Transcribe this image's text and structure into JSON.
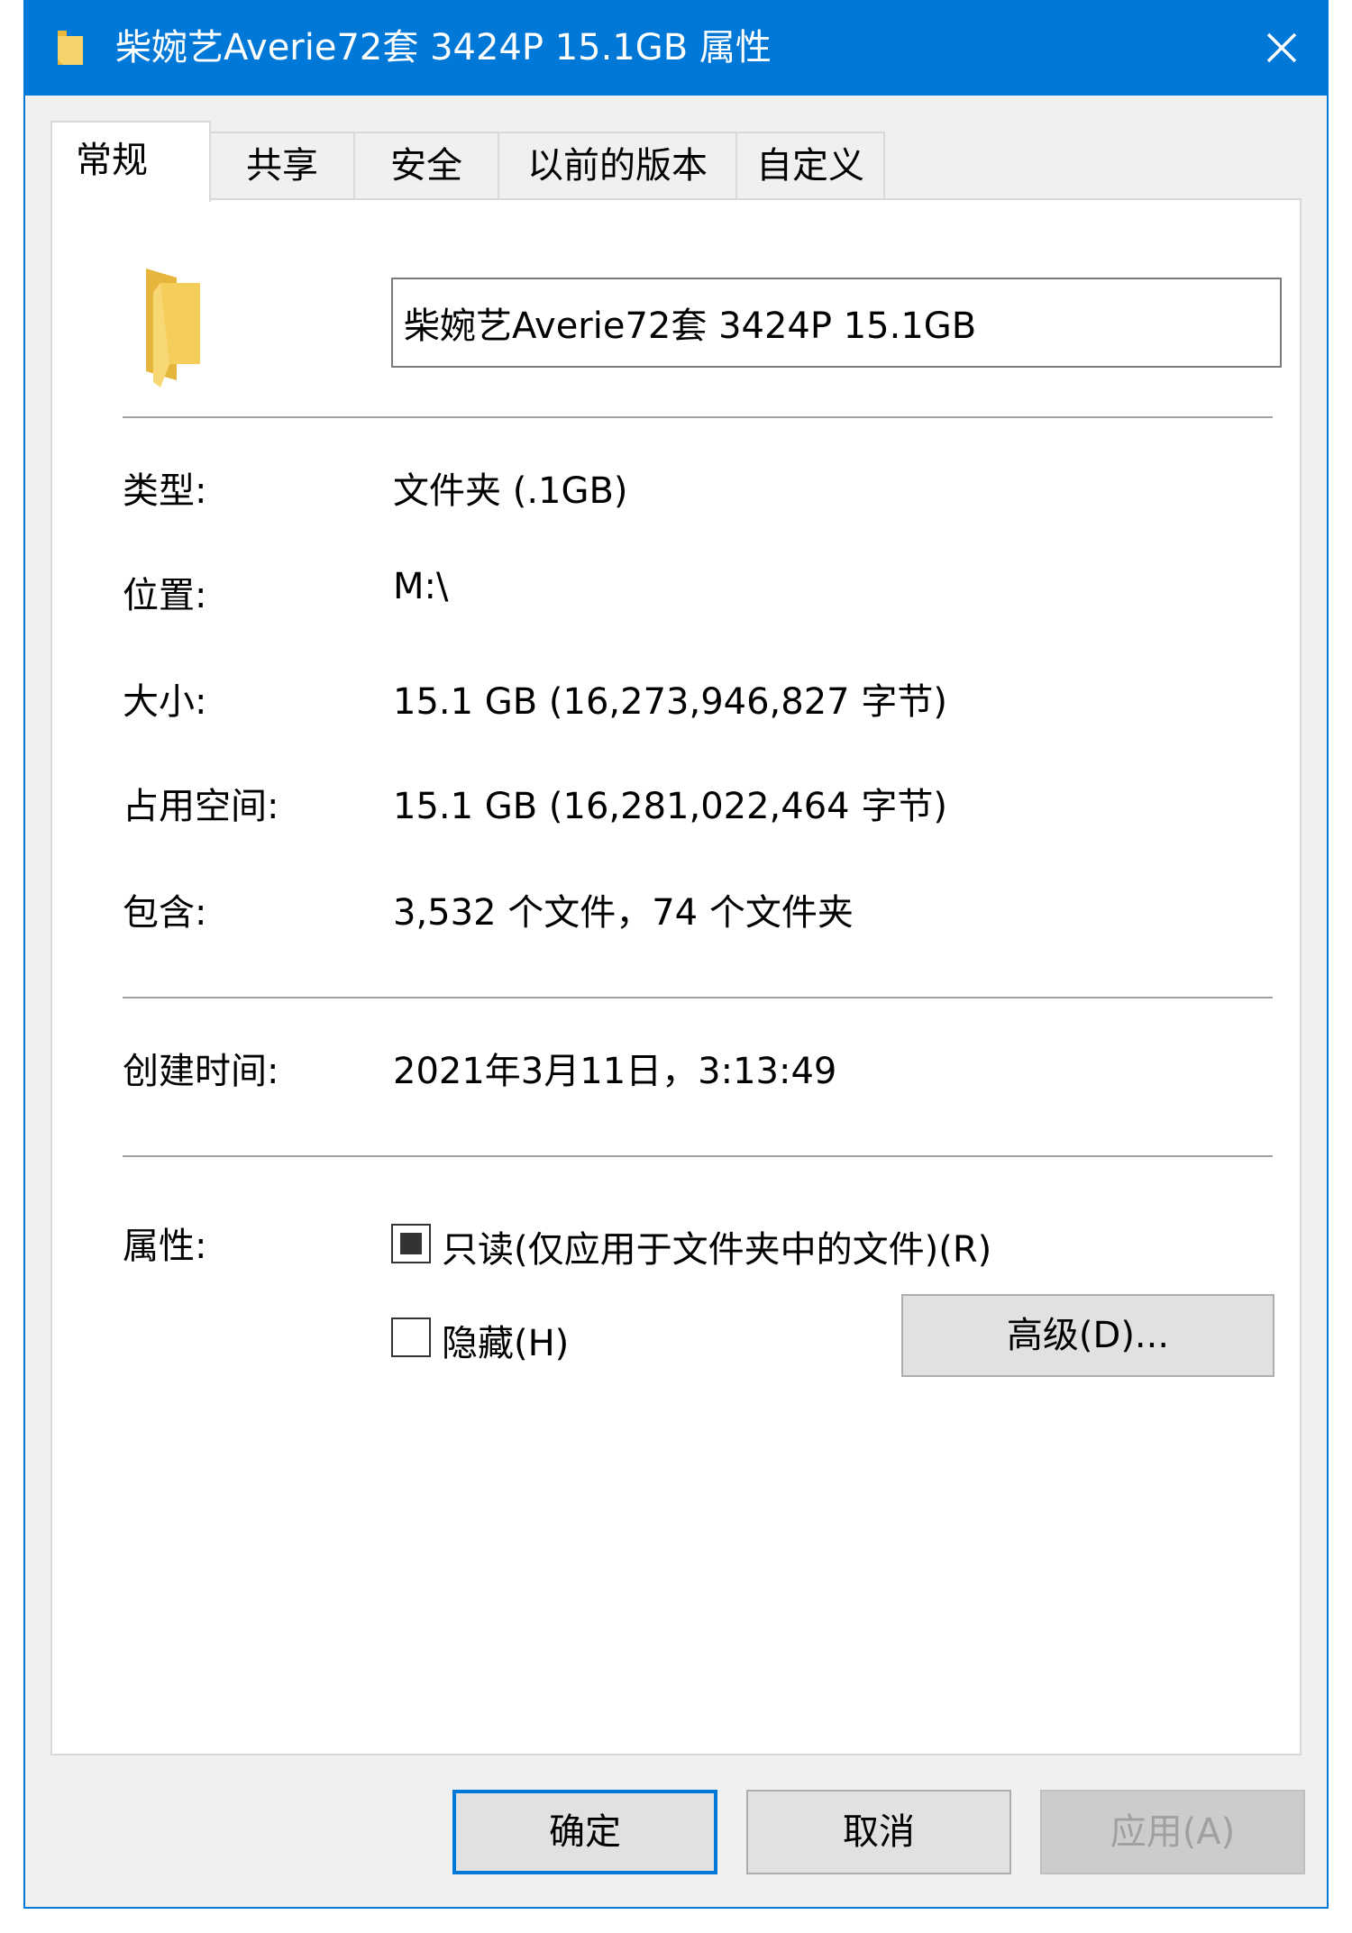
{
  "window": {
    "title": "柴婉艺Averie72套 3424P 15.1GB 属性",
    "accent_color": "#0078d7",
    "close_icon": "close-icon"
  },
  "tabs": [
    {
      "label": "常规",
      "active": true
    },
    {
      "label": "共享"
    },
    {
      "label": "安全"
    },
    {
      "label": "以前的版本"
    },
    {
      "label": "自定义"
    }
  ],
  "general": {
    "name_value": "柴婉艺Averie72套 3424P 15.1GB",
    "type": {
      "label": "类型:",
      "value": "文件夹 (.1GB)"
    },
    "location": {
      "label": "位置:",
      "value": "M:\\"
    },
    "size": {
      "label": "大小:",
      "value": "15.1 GB (16,273,946,827 字节)"
    },
    "size_on_disk": {
      "label": "占用空间:",
      "value": "15.1 GB (16,281,022,464 字节)"
    },
    "contains": {
      "label": "包含:",
      "value": "3,532 个文件，74 个文件夹"
    },
    "created": {
      "label": "创建时间:",
      "value": "2021年3月11日，3:13:49"
    },
    "attributes": {
      "label": "属性:",
      "readonly_label": "只读(仅应用于文件夹中的文件)(R)",
      "readonly_state": "indeterminate",
      "hidden_label": "隐藏(H)",
      "hidden_checked": false,
      "advanced_button": "高级(D)..."
    }
  },
  "buttons": {
    "ok": "确定",
    "cancel": "取消",
    "apply": "应用(A)"
  }
}
